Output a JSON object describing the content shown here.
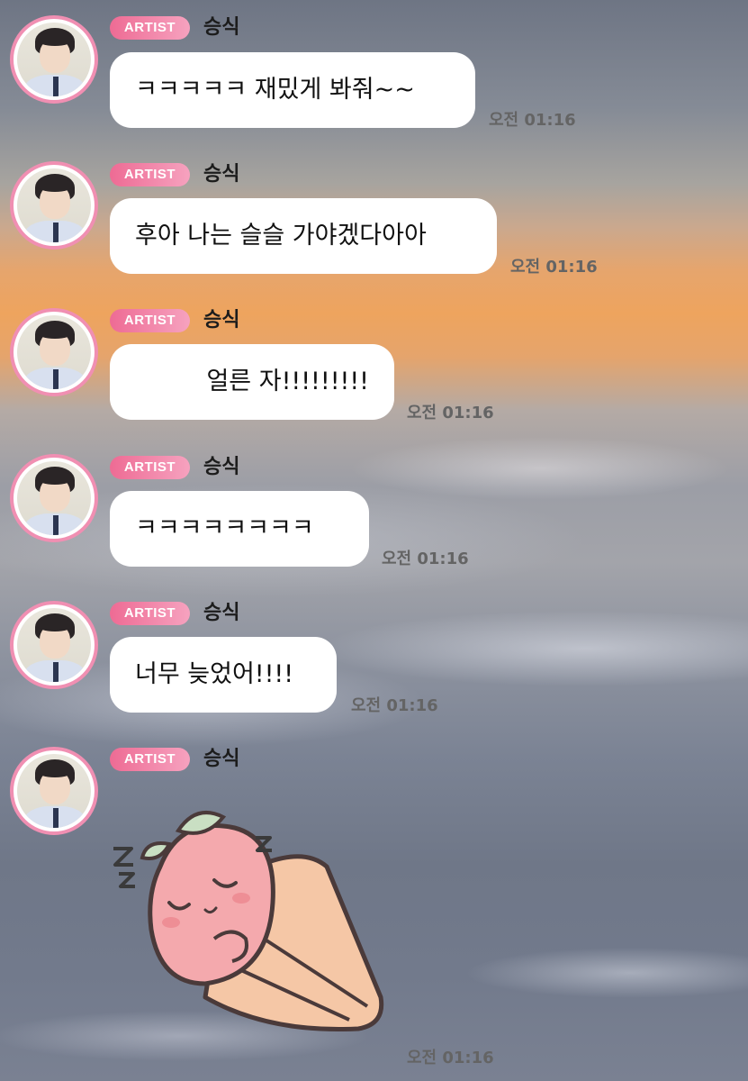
{
  "messages": [
    {
      "badge": "ARTIST",
      "sender": "승식",
      "text": "ㅋㅋㅋㅋㅋ 재밌게 봐줘~~",
      "time": "오전 01:16"
    },
    {
      "badge": "ARTIST",
      "sender": "승식",
      "text": "후아 나는 슬슬 가야겠다아아",
      "time": "오전 01:16"
    },
    {
      "badge": "ARTIST",
      "sender": "승식",
      "text": "얼른 자!!!!!!!!!",
      "time": "오전 01:16"
    },
    {
      "badge": "ARTIST",
      "sender": "승식",
      "text": "ㅋㅋㅋㅋㅋㅋㅋㅋ",
      "time": "오전 01:16"
    },
    {
      "badge": "ARTIST",
      "sender": "승식",
      "text": "너무 늦었어!!!!",
      "time": "오전 01:16"
    },
    {
      "badge": "ARTIST",
      "sender": "승식",
      "sticker": "sleeping-peach-sticker",
      "time": "오전 01:16"
    }
  ],
  "colors": {
    "badge": "#ee6b94",
    "avatar_ring": "#f08fb2",
    "bubble": "#ffffff",
    "time": "#646464"
  }
}
